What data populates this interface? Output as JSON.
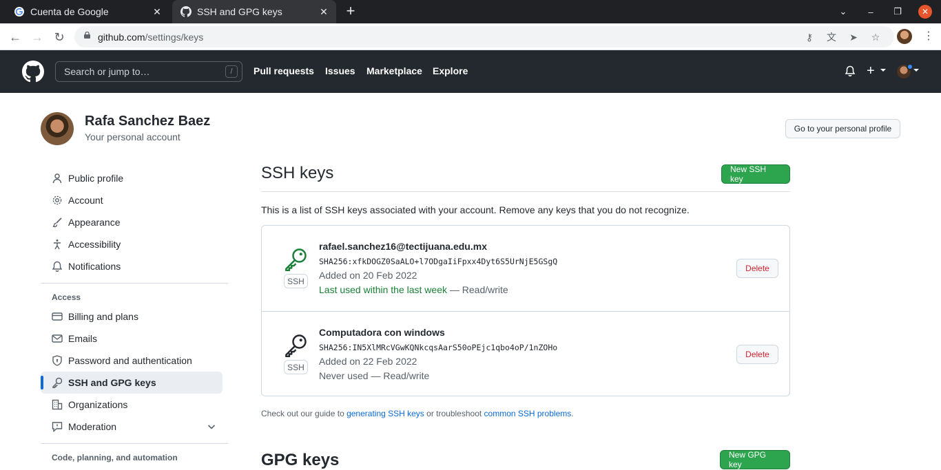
{
  "browser": {
    "tabs": [
      {
        "title": "Cuenta de Google",
        "favicon": "google-icon",
        "active": false
      },
      {
        "title": "SSH and GPG keys",
        "favicon": "github-icon",
        "active": true
      }
    ],
    "url_host": "github.com",
    "url_path": "/settings/keys"
  },
  "gh_header": {
    "search_placeholder": "Search or jump to…",
    "search_shortcut": "/",
    "nav": [
      "Pull requests",
      "Issues",
      "Marketplace",
      "Explore"
    ]
  },
  "user": {
    "name": "Rafa Sanchez Baez",
    "subtitle": "Your personal account",
    "profile_button": "Go to your personal profile"
  },
  "sidebar": {
    "items_top": [
      {
        "label": "Public profile",
        "icon": "person-icon"
      },
      {
        "label": "Account",
        "icon": "gear-icon"
      },
      {
        "label": "Appearance",
        "icon": "paintbrush-icon"
      },
      {
        "label": "Accessibility",
        "icon": "accessibility-icon"
      },
      {
        "label": "Notifications",
        "icon": "bell-icon"
      }
    ],
    "access_heading": "Access",
    "items_access": [
      {
        "label": "Billing and plans",
        "icon": "credit-card-icon"
      },
      {
        "label": "Emails",
        "icon": "mail-icon"
      },
      {
        "label": "Password and authentication",
        "icon": "shield-lock-icon"
      },
      {
        "label": "SSH and GPG keys",
        "icon": "key-icon",
        "active": true
      },
      {
        "label": "Organizations",
        "icon": "organization-icon"
      },
      {
        "label": "Moderation",
        "icon": "report-icon"
      }
    ],
    "next_heading": "Code, planning, and automation"
  },
  "ssh": {
    "title": "SSH keys",
    "new_button": "New SSH key",
    "intro": "This is a list of SSH keys associated with your account. Remove any keys that you do not recognize.",
    "keys": [
      {
        "name": "rafael.sanchez16@tectijuana.edu.mx",
        "fingerprint": "SHA256:xfkDOGZ0SaALO+l7ODgaIiFpxx4Dyt6S5UrNjE5GSgQ",
        "added": "Added on 20 Feb 2022",
        "used": "Last used within the last week",
        "access": " — Read/write",
        "badge": "SSH",
        "delete": "Delete",
        "icon_color": "#1a7f37"
      },
      {
        "name": "Computadora con windows",
        "fingerprint": "SHA256:IN5XlMRcVGwKQNkcqsAarS50oPEjc1qbo4oP/1nZOHo",
        "added": "Added on 22 Feb 2022",
        "used": "Never used",
        "access": " — Read/write",
        "badge": "SSH",
        "delete": "Delete",
        "icon_color": "#24292f"
      }
    ],
    "guide_prefix": "Check out our guide to ",
    "guide_link1": "generating SSH keys",
    "guide_middle": " or troubleshoot ",
    "guide_link2": "common SSH problems",
    "guide_suffix": "."
  },
  "gpg": {
    "title": "GPG keys",
    "new_button": "New GPG key"
  }
}
